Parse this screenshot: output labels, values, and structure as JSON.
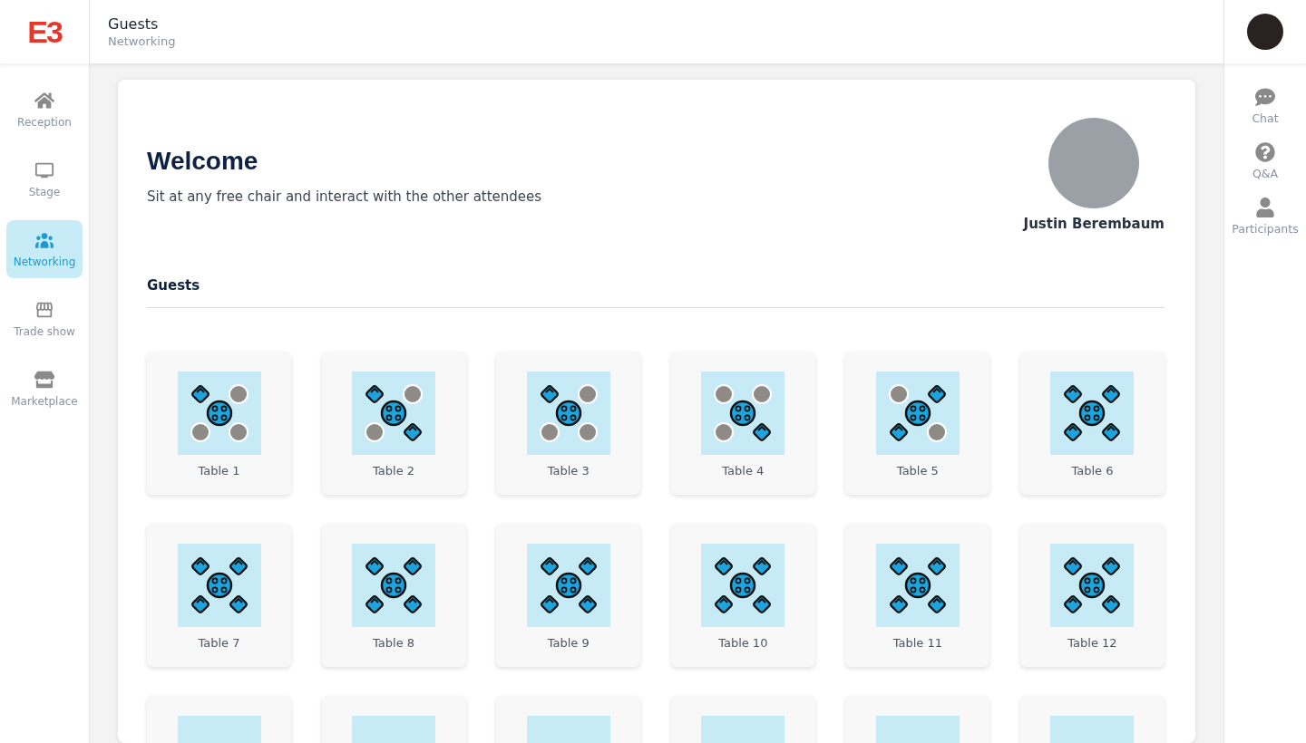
{
  "header": {
    "logo": "E3",
    "title": "Guests",
    "subtitle": "Networking"
  },
  "nav": [
    {
      "label": "Reception",
      "selected": false
    },
    {
      "label": "Stage",
      "selected": false
    },
    {
      "label": "Networking",
      "selected": true
    },
    {
      "label": "Trade show",
      "selected": false
    },
    {
      "label": "Marketplace",
      "selected": false
    }
  ],
  "side_panel": [
    {
      "label": "Chat"
    },
    {
      "label": "Q&A"
    },
    {
      "label": "Participants"
    }
  ],
  "welcome": {
    "title": "Welcome",
    "text": "Sit at any free chair and interact with the other attendees",
    "host": "Justin Berembaum"
  },
  "section_title": "Guests",
  "tables": [
    {
      "kind": "table",
      "label": "Table 1",
      "seats": [
        false,
        true,
        true,
        true
      ]
    },
    {
      "kind": "table",
      "label": "Table 2",
      "seats": [
        false,
        true,
        true,
        false
      ]
    },
    {
      "kind": "table",
      "label": "Table 3",
      "seats": [
        false,
        true,
        true,
        true
      ]
    },
    {
      "kind": "table",
      "label": "Table 4",
      "seats": [
        true,
        true,
        true,
        false
      ]
    },
    {
      "kind": "table",
      "label": "Table 5",
      "seats": [
        true,
        false,
        false,
        true
      ]
    },
    {
      "kind": "table",
      "label": "Table 6",
      "seats": [
        false,
        false,
        false,
        false
      ]
    },
    {
      "kind": "table",
      "label": "Table 7",
      "seats": [
        false,
        false,
        false,
        false
      ]
    },
    {
      "kind": "table",
      "label": "Table 8",
      "seats": [
        false,
        false,
        false,
        false
      ]
    },
    {
      "kind": "table",
      "label": "Table 9",
      "seats": [
        false,
        false,
        false,
        false
      ]
    },
    {
      "kind": "table",
      "label": "Table 10",
      "seats": [
        false,
        false,
        false,
        false
      ]
    },
    {
      "kind": "table",
      "label": "Table 11",
      "seats": [
        false,
        false,
        false,
        false
      ]
    },
    {
      "kind": "table",
      "label": "Table 12",
      "seats": [
        false,
        false,
        false,
        false
      ]
    },
    {
      "kind": "cut"
    },
    {
      "kind": "cut"
    },
    {
      "kind": "cut"
    },
    {
      "kind": "cut"
    },
    {
      "kind": "cut"
    },
    {
      "kind": "cut"
    }
  ]
}
